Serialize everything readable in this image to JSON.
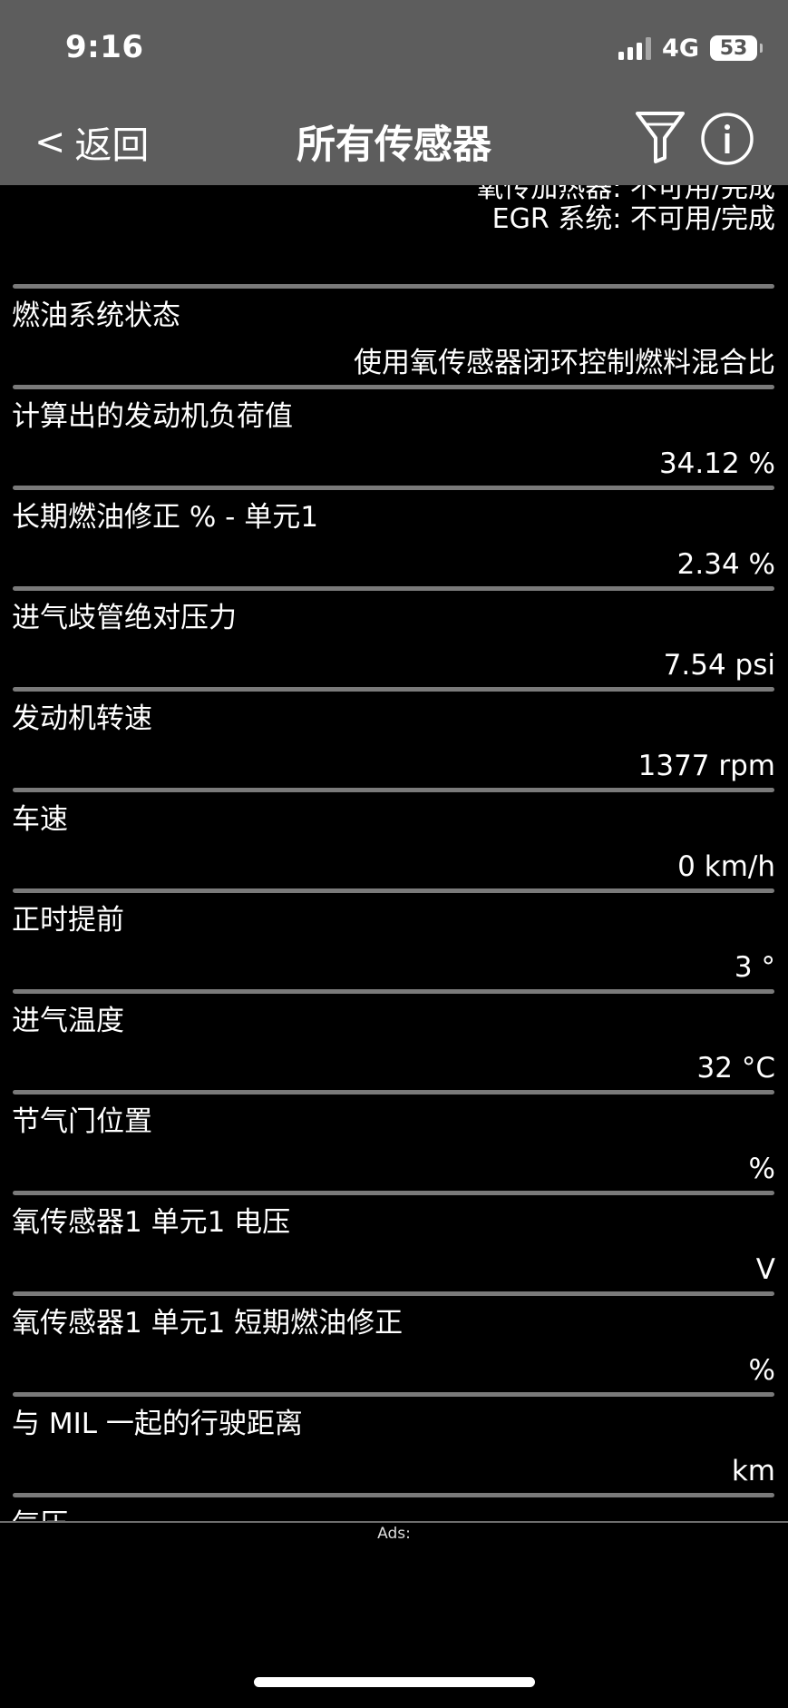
{
  "status_bar": {
    "time": "9:16",
    "network": "4G",
    "battery": "53"
  },
  "nav": {
    "back_label": "返回",
    "back_chevron": "<",
    "title": "所有传感器",
    "filter_icon": "funnel-icon",
    "info_icon": "info-icon"
  },
  "readiness": {
    "line1": "氧传加热器: 不可用/完成",
    "line2": "EGR 系统: 不可用/完成"
  },
  "sensors": [
    {
      "label": "燃油系统状态",
      "value": "使用氧传感器闭环控制燃料混合比"
    },
    {
      "label": "计算出的发动机负荷值",
      "value": "34.12 %"
    },
    {
      "label": "长期燃油修正 % - 单元1",
      "value": "2.34 %"
    },
    {
      "label": "进气歧管绝对压力",
      "value": "7.54 psi"
    },
    {
      "label": "发动机转速",
      "value": "1377 rpm"
    },
    {
      "label": "车速",
      "value": "0 km/h"
    },
    {
      "label": "正时提前",
      "value": "3 °"
    },
    {
      "label": "进气温度",
      "value": "32 °C"
    },
    {
      "label": "节气门位置",
      "value": "%"
    },
    {
      "label": "氧传感器1 单元1 电压",
      "value": "V"
    },
    {
      "label": "氧传感器1 单元1 短期燃油修正",
      "value": "%"
    },
    {
      "label": "与 MIL 一起的行驶距离",
      "value": "km"
    },
    {
      "label": "气压",
      "value": ""
    }
  ],
  "ads": {
    "label": "Ads:"
  }
}
